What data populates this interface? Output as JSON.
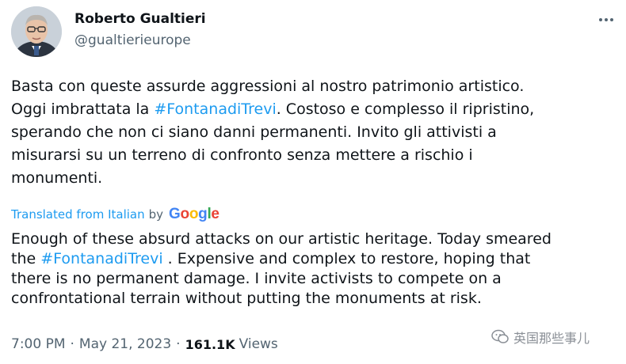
{
  "author": {
    "name": "Roberto Gualtieri",
    "handle": "@gualtierieurope"
  },
  "icons": {
    "avatar": "avatar",
    "more": "more-horizontal-icon",
    "watermark": "wechat-icon"
  },
  "tweet": {
    "line1": "Basta con queste assurde aggressioni al nostro patrimonio artistico.",
    "line2_pre": "Oggi imbrattata la ",
    "hashtag": "#FontanadiTrevi",
    "line2_post": ". Costoso e complesso il ripristino,",
    "line3": "sperando che non ci siano danni permanenti. Invito gli attivisti a",
    "line4": "misurarsi su un terreno di confronto senza mettere a rischio i",
    "line5": "monumenti."
  },
  "translation": {
    "label": "Translated from Italian",
    "by": "by",
    "google_letters": [
      "G",
      "o",
      "o",
      "g",
      "l",
      "e"
    ],
    "line1": "Enough of these absurd attacks on our artistic heritage. Today smeared",
    "line2_pre": "the ",
    "hashtag": "#FontanadiTrevi",
    "line2_post": " . Expensive and complex to restore, hoping that",
    "line3": "there is no permanent damage. I invite activists to compete on a",
    "line4": "confrontational terrain without putting the monuments at risk."
  },
  "meta": {
    "time": "7:00 PM",
    "date": "May 21, 2023",
    "separator": "·",
    "views_count": "161.1K",
    "views_label": "Views"
  },
  "watermark": {
    "text": "英国那些事儿"
  },
  "colors": {
    "link": "#1d9bf0",
    "secondary": "#536471",
    "google_blue": "#4285f4",
    "google_red": "#ea4335",
    "google_yellow": "#fbbc05",
    "google_green": "#34a853"
  }
}
